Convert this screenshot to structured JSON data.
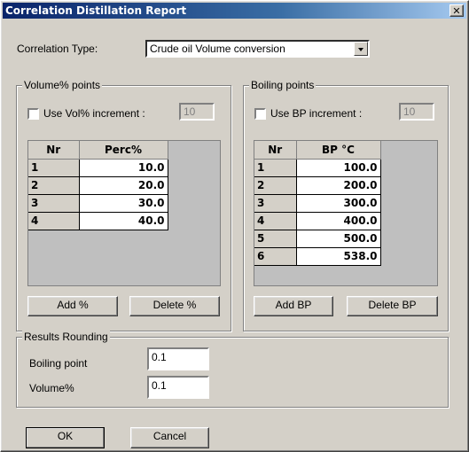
{
  "window": {
    "title": "Correlation Distillation Report",
    "close_glyph": "✕"
  },
  "correlation_type": {
    "label": "Correlation Type:",
    "value": "Crude oil Volume conversion"
  },
  "volume_points": {
    "title": "Volume% points",
    "increment_label": "Use Vol% increment :",
    "increment_value": "10",
    "headers": [
      "Nr",
      "Perc%"
    ],
    "rows": [
      {
        "nr": "1",
        "value": "10.0"
      },
      {
        "nr": "2",
        "value": "20.0"
      },
      {
        "nr": "3",
        "value": "30.0"
      },
      {
        "nr": "4",
        "value": "40.0"
      }
    ],
    "add_label": "Add %",
    "delete_label": "Delete %"
  },
  "boiling_points": {
    "title": "Boiling points",
    "increment_label": "Use BP increment :",
    "increment_value": "10",
    "headers": [
      "Nr",
      "BP °C"
    ],
    "rows": [
      {
        "nr": "1",
        "value": "100.0"
      },
      {
        "nr": "2",
        "value": "200.0"
      },
      {
        "nr": "3",
        "value": "300.0"
      },
      {
        "nr": "4",
        "value": "400.0"
      },
      {
        "nr": "5",
        "value": "500.0"
      },
      {
        "nr": "6",
        "value": "538.0"
      }
    ],
    "add_label": "Add BP",
    "delete_label": "Delete BP"
  },
  "rounding": {
    "title": "Results Rounding",
    "bp_label": "Boiling point",
    "bp_value": "0.1",
    "vol_label": "Volume%",
    "vol_value": "0.1"
  },
  "buttons": {
    "ok": "OK",
    "cancel": "Cancel"
  }
}
